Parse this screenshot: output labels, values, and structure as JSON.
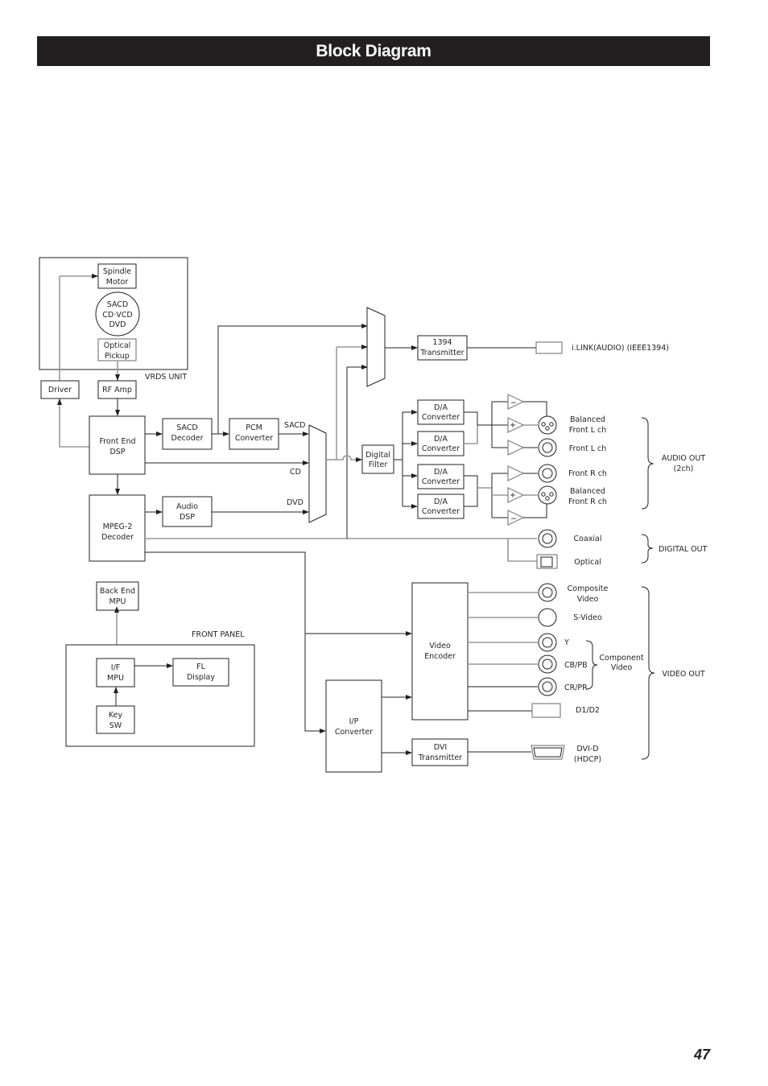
{
  "page": {
    "title": "Block Diagram",
    "page_number": "47"
  },
  "diagram": {
    "vrds_unit": {
      "label": "VRDS UNIT",
      "spindle_motor": [
        "Spindle",
        "Motor"
      ],
      "disc": [
        "SACD",
        "CD·VCD",
        "DVD"
      ],
      "optical_pickup": [
        "Optical",
        "Pickup"
      ]
    },
    "driver": "Driver",
    "rf_amp": "RF Amp",
    "front_end_dsp": [
      "Front End",
      "DSP"
    ],
    "sacd_decoder": [
      "SACD",
      "Decoder"
    ],
    "pcm_converter": [
      "PCM",
      "Converter"
    ],
    "mpeg2_decoder": [
      "MPEG-2",
      "Decoder"
    ],
    "audio_dsp": [
      "Audio",
      "DSP"
    ],
    "mux_inputs": {
      "sacd": "SACD",
      "cd": "CD",
      "dvd": "DVD"
    },
    "transmitter_1394": [
      "1394",
      "Transmitter"
    ],
    "ilink_label": "i.LINK(AUDIO) (IEEE1394)",
    "digital_filter": [
      "Digital",
      "Filter"
    ],
    "da_converter": [
      "D/A",
      "Converter"
    ],
    "amp_signs": {
      "minus": "−",
      "plus": "+"
    },
    "audio_outputs": [
      [
        "Balanced",
        "Front L ch"
      ],
      [
        "Front L ch"
      ],
      [
        "Front R ch"
      ],
      [
        "Balanced",
        "Front R ch"
      ]
    ],
    "audio_out_group": [
      "AUDIO OUT",
      "(2ch)"
    ],
    "digital_outputs": [
      "Coaxial",
      "Optical"
    ],
    "digital_out_group": "DIGITAL OUT",
    "video_encoder": [
      "Video",
      "Encoder"
    ],
    "ip_converter": [
      "I/P",
      "Converter"
    ],
    "dvi_transmitter": [
      "DVI",
      "Transmitter"
    ],
    "video_outputs": {
      "composite": [
        "Composite",
        "Video"
      ],
      "svideo": "S-Video",
      "y": "Y",
      "cb": "CB/PB",
      "cr": "CR/PR",
      "d1d2": "D1/D2",
      "dvi": [
        "DVI-D",
        "(HDCP)"
      ]
    },
    "component_group": [
      "Component",
      "Video"
    ],
    "video_out_group": "VIDEO OUT",
    "front_panel": {
      "label": "FRONT PANEL",
      "back_end_mpu": [
        "Back End",
        "MPU"
      ],
      "if_mpu": [
        "I/F",
        "MPU"
      ],
      "fl_display": [
        "FL",
        "Display"
      ],
      "key_sw": [
        "Key",
        "SW"
      ]
    }
  }
}
